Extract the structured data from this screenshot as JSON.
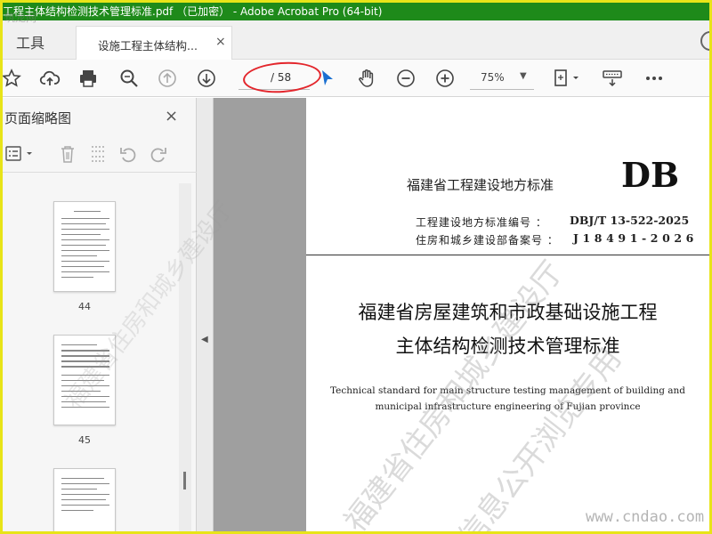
{
  "window": {
    "title": "工程主体结构检测技术管理标准.pdf （已加密） - Adobe Acrobat Pro (64-bit)",
    "watermark_logo": "筑龙网"
  },
  "tabs": {
    "tools_label": "工具",
    "document_tab_label": "设施工程主体结构...",
    "close_glyph": "×"
  },
  "toolbar": {
    "page_current": "",
    "page_total": "/ 58",
    "zoom": "75%",
    "icons": [
      "star-icon",
      "cloud-upload-icon",
      "print-icon",
      "zoom-search-icon",
      "arrow-up-circle-icon",
      "arrow-down-circle-icon",
      "cursor-icon",
      "hand-icon",
      "zoom-out-icon",
      "zoom-in-icon",
      "fit-page-icon",
      "keyboard-icon",
      "more-icon"
    ],
    "highlight_color": "#e3262c"
  },
  "sidebar": {
    "title": "页面缩略图",
    "close_glyph": "×",
    "thumbnails": [
      {
        "label": "44"
      },
      {
        "label": "45"
      },
      {
        "label": ""
      }
    ]
  },
  "document": {
    "standard_title": "福建省工程建设地方标准",
    "db_mark": "DB",
    "code_label": "工程建设地方标准编号 ：",
    "code_value": "DBJ/T 13-522-2025",
    "record_label": "住房和城乡建设部备案号 ：",
    "record_value": "J18491-2026",
    "cn_title_line1": "福建省房屋建筑和市政基础设施工程",
    "cn_title_line2": "主体结构检测技术管理标准",
    "en_title_line1": "Technical standard for main structure testing management of building and",
    "en_title_line2": "municipal infrastructure engineering of Fujian province"
  },
  "watermarks": {
    "line1": "福建省住房和城乡建设厅",
    "line2": "信息公开浏览专用",
    "line3": "福建省住房和城乡建设厅",
    "site": "www.cndao.com"
  },
  "colors": {
    "title_bar": "#1e8a1a",
    "outer_border": "#e8e418",
    "doc_background": "#9f9f9f"
  }
}
